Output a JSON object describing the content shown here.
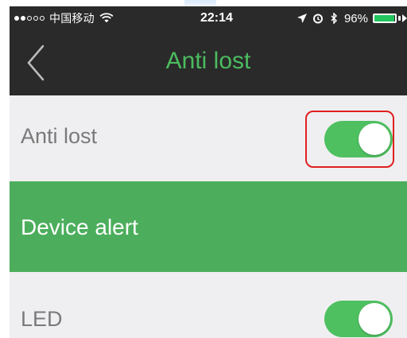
{
  "status_bar": {
    "signal_dots_filled": 2,
    "signal_dots_total": 5,
    "carrier": "中国移动",
    "time": "22:14",
    "battery_percent_label": "96%",
    "battery_level": 0.96,
    "icons": [
      "wifi-icon",
      "location-arrow-icon",
      "alarm-icon",
      "bluetooth-icon",
      "battery-icon"
    ],
    "battery_color": "#22c55e"
  },
  "nav": {
    "title": "Anti lost",
    "back_icon": "chevron-left-icon",
    "title_color": "#4cbb5f"
  },
  "settings": {
    "anti_lost": {
      "label": "Anti lost",
      "toggle_on": true
    },
    "section_header": "Device alert",
    "section_color": "#4cae5c",
    "led": {
      "label": "LED",
      "toggle_on": true
    }
  },
  "colors": {
    "toggle_on": "#4ec060",
    "highlight": "#e02020",
    "row_bg": "#efeff1",
    "bar_bg": "#2a2a2a"
  }
}
